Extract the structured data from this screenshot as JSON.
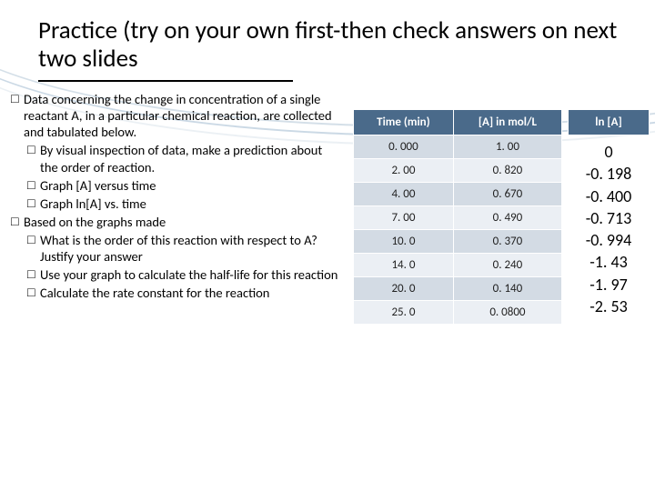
{
  "title": "Practice (try on your own first-then check answers on next two slides",
  "bullets": {
    "b1": "Data concerning the change in concentration of a single reactant A, in a particular chemical reaction, are collected and tabulated below.",
    "b1a": "By visual inspection of data, make a prediction about the order of reaction.",
    "b1b": "Graph [A] versus time",
    "b1c": "Graph ln[A] vs. time",
    "b2": "Based on the graphs made",
    "b2a": "What is the order of this reaction with respect to A? Justify your answer",
    "b2b": "Use your graph to calculate the half-life for this reaction",
    "b2c": "Calculate the rate constant for the reaction"
  },
  "table": {
    "headers": {
      "time": "Time (min)",
      "conc": "[A] in mol/L",
      "ln": "ln [A]"
    },
    "rows": [
      {
        "time": "0. 000",
        "conc": "1. 00"
      },
      {
        "time": "2. 00",
        "conc": "0. 820"
      },
      {
        "time": "4. 00",
        "conc": "0. 670"
      },
      {
        "time": "7. 00",
        "conc": "0. 490"
      },
      {
        "time": "10. 0",
        "conc": "0. 370"
      },
      {
        "time": "14. 0",
        "conc": "0. 240"
      },
      {
        "time": "20. 0",
        "conc": "0. 140"
      },
      {
        "time": "25. 0",
        "conc": "0. 0800"
      }
    ],
    "ln_values": [
      "0",
      "-0. 198",
      "-0. 400",
      "-0. 713",
      "-0. 994",
      "-1. 43",
      "-1. 97",
      "-2. 53"
    ]
  }
}
